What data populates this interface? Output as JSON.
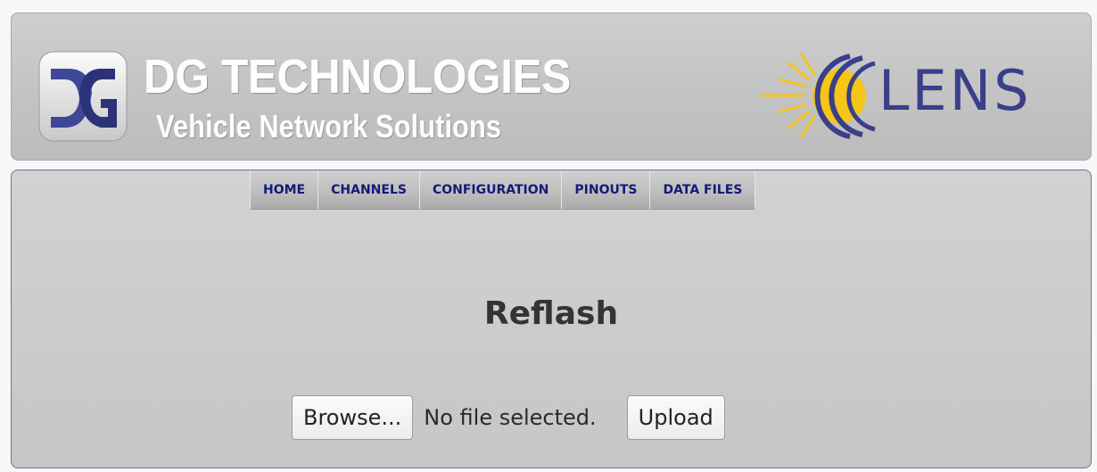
{
  "header": {
    "brand_title": "DG TECHNOLOGIES",
    "brand_subtitle": "Vehicle Network Solutions",
    "product_name": "LENS",
    "logo_icon": "dg-logo-icon",
    "product_logo_icon": "lens-sun-icon"
  },
  "nav": {
    "items": [
      {
        "label": "HOME"
      },
      {
        "label": "CHANNELS"
      },
      {
        "label": "CONFIGURATION"
      },
      {
        "label": "PINOUTS"
      },
      {
        "label": "DATA FILES"
      }
    ]
  },
  "main": {
    "title": "Reflash",
    "browse_label": "Browse...",
    "file_status": "No file selected.",
    "upload_label": "Upload"
  },
  "colors": {
    "nav_text": "#141a78",
    "lens_text": "#3a3f8a",
    "sun": "#f5c518"
  }
}
